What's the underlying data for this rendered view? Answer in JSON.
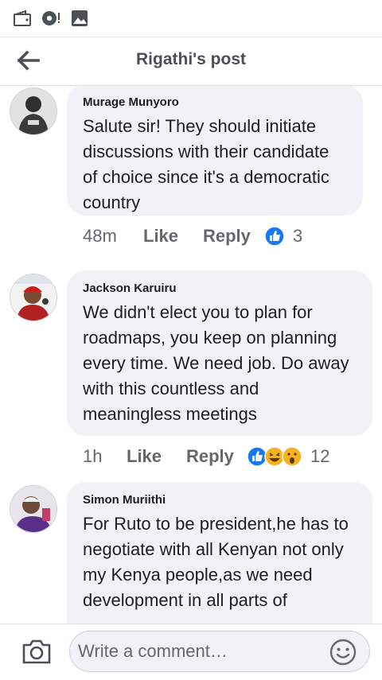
{
  "status_bar": {
    "icons": [
      "wallet-notification-icon",
      "chat-notification-icon",
      "image-notification-icon"
    ]
  },
  "header": {
    "title": "Rigathi's post",
    "back_icon": "arrow-left-icon"
  },
  "comments": [
    {
      "author": "Murage Munyoro",
      "text": "Salute sir! They should initiate discussions with their candidate of choice since it's a democratic country",
      "time": "48m",
      "like_label": "Like",
      "reply_label": "Reply",
      "reactions": [
        "like"
      ],
      "reaction_count": "3"
    },
    {
      "author": "Jackson Karuiru",
      "text": "We didn't elect you to plan for roadmaps, you keep on planning every time. We need job. Do away with this countless and meaningless meetings",
      "time": "1h",
      "like_label": "Like",
      "reply_label": "Reply",
      "reactions": [
        "like",
        "haha",
        "wow"
      ],
      "reaction_count": "12"
    },
    {
      "author": "Simon Muriithi",
      "text": "For Ruto to be president,he has to negotiate with all Kenyan not only my Kenya people,as we need development in all parts of"
    }
  ],
  "composer": {
    "placeholder": "Write a comment…",
    "camera_icon": "camera-icon",
    "emoji_icon": "smiley-emoji-icon"
  },
  "colors": {
    "like_blue": "#1877f2",
    "bubble_bg": "#f0f2f5",
    "meta_gray": "#65676b"
  }
}
